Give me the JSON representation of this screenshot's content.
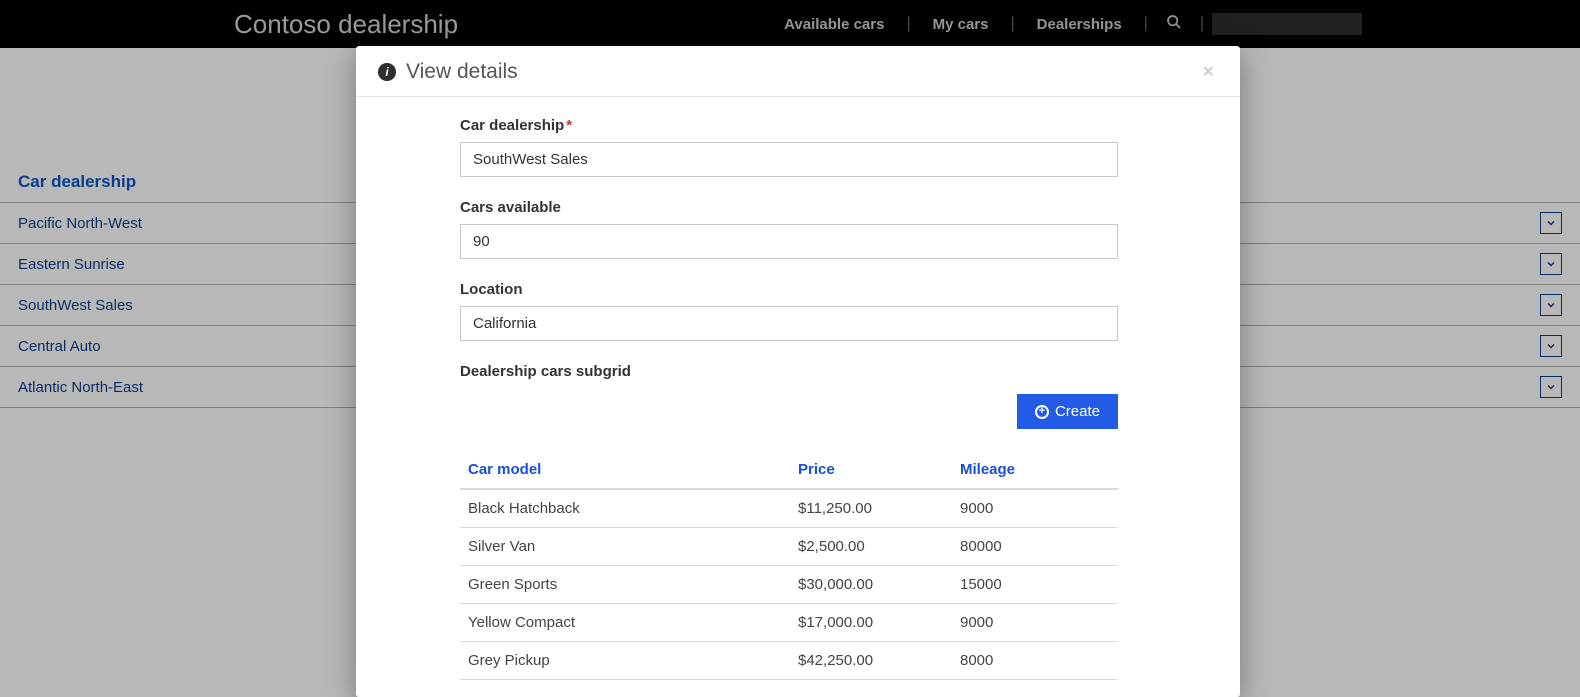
{
  "nav": {
    "brand": "Contoso dealership",
    "links": [
      "Available cars",
      "My cars",
      "Dealerships"
    ]
  },
  "backgroundList": {
    "header": "Car dealership",
    "items": [
      "Pacific North-West",
      "Eastern Sunrise",
      "SouthWest Sales",
      "Central Auto",
      "Atlantic North-East"
    ]
  },
  "modal": {
    "title": "View details",
    "fields": {
      "dealership": {
        "label": "Car dealership",
        "required": true,
        "value": "SouthWest Sales"
      },
      "available": {
        "label": "Cars available",
        "required": false,
        "value": "90"
      },
      "location": {
        "label": "Location",
        "required": false,
        "value": "California"
      }
    },
    "subgrid": {
      "label": "Dealership cars subgrid",
      "createLabel": "Create",
      "columns": [
        "Car model",
        "Price",
        "Mileage"
      ],
      "rows": [
        {
          "model": "Black Hatchback",
          "price": "$11,250.00",
          "mileage": "9000"
        },
        {
          "model": "Silver Van",
          "price": "$2,500.00",
          "mileage": "80000"
        },
        {
          "model": "Green Sports",
          "price": "$30,000.00",
          "mileage": "15000"
        },
        {
          "model": "Yellow Compact",
          "price": "$17,000.00",
          "mileage": "9000"
        },
        {
          "model": "Grey Pickup",
          "price": "$42,250.00",
          "mileage": "8000"
        }
      ]
    }
  }
}
